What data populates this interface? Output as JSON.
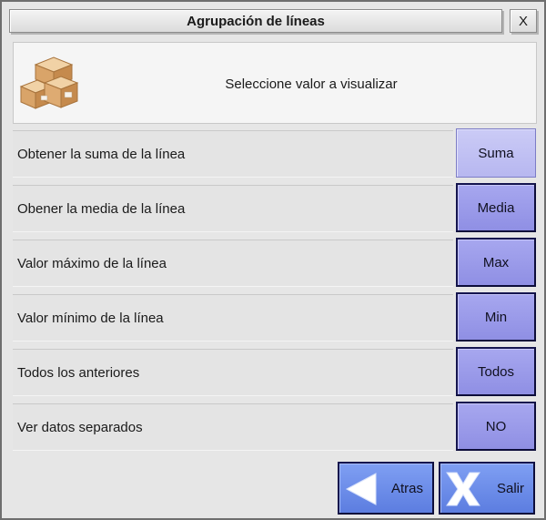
{
  "window": {
    "title": "Agrupación de líneas",
    "close_label": "X"
  },
  "header": {
    "icon": "boxes-icon",
    "prompt": "Seleccione valor a visualizar"
  },
  "options": [
    {
      "label": "Obtener la suma de la línea",
      "button": "Suma",
      "selected": true
    },
    {
      "label": "Obener la media de la línea",
      "button": "Media",
      "selected": false
    },
    {
      "label": "Valor máximo de la línea",
      "button": "Max",
      "selected": false
    },
    {
      "label": "Valor mínimo de la línea",
      "button": "Min",
      "selected": false
    },
    {
      "label": "Todos los anteriores",
      "button": "Todos",
      "selected": false
    },
    {
      "label": "Ver datos separados",
      "button": "NO",
      "selected": false
    }
  ],
  "footer": {
    "back_label": "Atras",
    "back_icon": "arrow-left-icon",
    "exit_label": "Salir",
    "exit_icon": "x-mark-icon"
  },
  "colors": {
    "button_fill": "#9b9bea",
    "button_selected_fill": "#c1c1f3",
    "nav_button_fill": "#6e8eea",
    "button_border": "#15154f"
  }
}
